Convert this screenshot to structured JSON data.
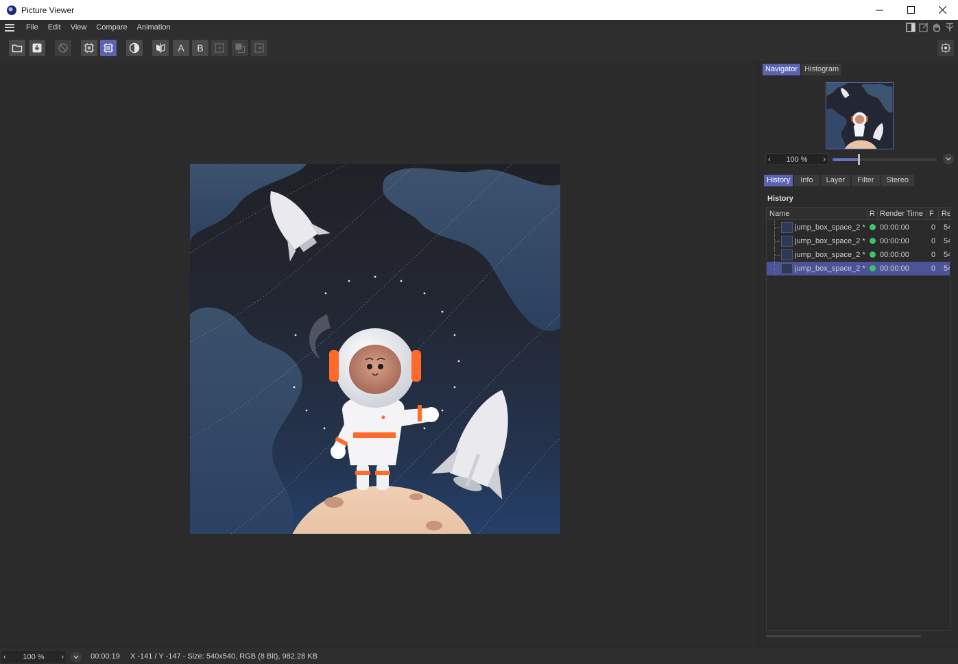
{
  "window": {
    "title": "Picture Viewer",
    "icon": "cinema4d-icon",
    "controls": [
      "minimize-icon",
      "maximize-icon",
      "close-icon"
    ]
  },
  "menu": {
    "items": [
      "File",
      "Edit",
      "View",
      "Compare",
      "Animation"
    ],
    "right_icons": [
      "panel-toggle-icon",
      "external-window-icon",
      "hand-pan-icon",
      "pin-icon"
    ]
  },
  "toolbar": {
    "buttons": [
      {
        "name": "open-file-icon",
        "active": false,
        "enabled": true
      },
      {
        "name": "save-download-icon",
        "active": false,
        "enabled": true
      },
      {
        "name": "stop-render-icon",
        "active": false,
        "enabled": false
      },
      {
        "name": "render-region-icon",
        "active": false,
        "enabled": true
      },
      {
        "name": "render-active-icon",
        "active": true,
        "enabled": true
      },
      {
        "name": "contrast-icon",
        "active": false,
        "enabled": true
      },
      {
        "name": "compare-ab-icon",
        "active": false,
        "enabled": true
      },
      {
        "name": "set-a-button",
        "label": "A",
        "active": false,
        "enabled": true
      },
      {
        "name": "set-b-button",
        "label": "B",
        "active": false,
        "enabled": true
      },
      {
        "name": "swap-ab-icon",
        "active": false,
        "enabled": false
      },
      {
        "name": "layer-overlay-icon",
        "active": false,
        "enabled": false
      },
      {
        "name": "layer-export-icon",
        "active": false,
        "enabled": false
      }
    ],
    "right_icon": "render-settings-icon"
  },
  "navigator": {
    "tabs": [
      {
        "label": "Navigator",
        "active": true
      },
      {
        "label": "Histogram",
        "active": false
      }
    ],
    "zoom": "100 %",
    "zoom_slider": 0.25
  },
  "history_panel": {
    "tabs": [
      {
        "label": "History",
        "active": true
      },
      {
        "label": "Info",
        "active": false
      },
      {
        "label": "Layer",
        "active": false
      },
      {
        "label": "Filter",
        "active": false
      },
      {
        "label": "Stereo",
        "active": false
      }
    ],
    "title": "History",
    "columns": [
      "Name",
      "R",
      "Render Time",
      "F",
      "Re"
    ],
    "rows": [
      {
        "name": "jump_box_space_2 *",
        "status_color": "#3ec26a",
        "render_time": "00:00:00",
        "frame": "0",
        "res": "54",
        "selected": false
      },
      {
        "name": "jump_box_space_2 *",
        "status_color": "#3ec26a",
        "render_time": "00:00:00",
        "frame": "0",
        "res": "54",
        "selected": false
      },
      {
        "name": "jump_box_space_2 *",
        "status_color": "#3ec26a",
        "render_time": "00:00:00",
        "frame": "0",
        "res": "54",
        "selected": false
      },
      {
        "name": "jump_box_space_2 *",
        "status_color": "#3ec26a",
        "render_time": "00:00:00",
        "frame": "0",
        "res": "54",
        "selected": true
      }
    ]
  },
  "status": {
    "zoom": "100 %",
    "time": "00:00:19",
    "info": "X -141 / Y -147 - Size: 540x540, RGB (8 Bit), 982.28 KB"
  },
  "colors": {
    "accent": "#5b62b2",
    "background": "#2b2b2b",
    "status_ok": "#3ec26a"
  }
}
